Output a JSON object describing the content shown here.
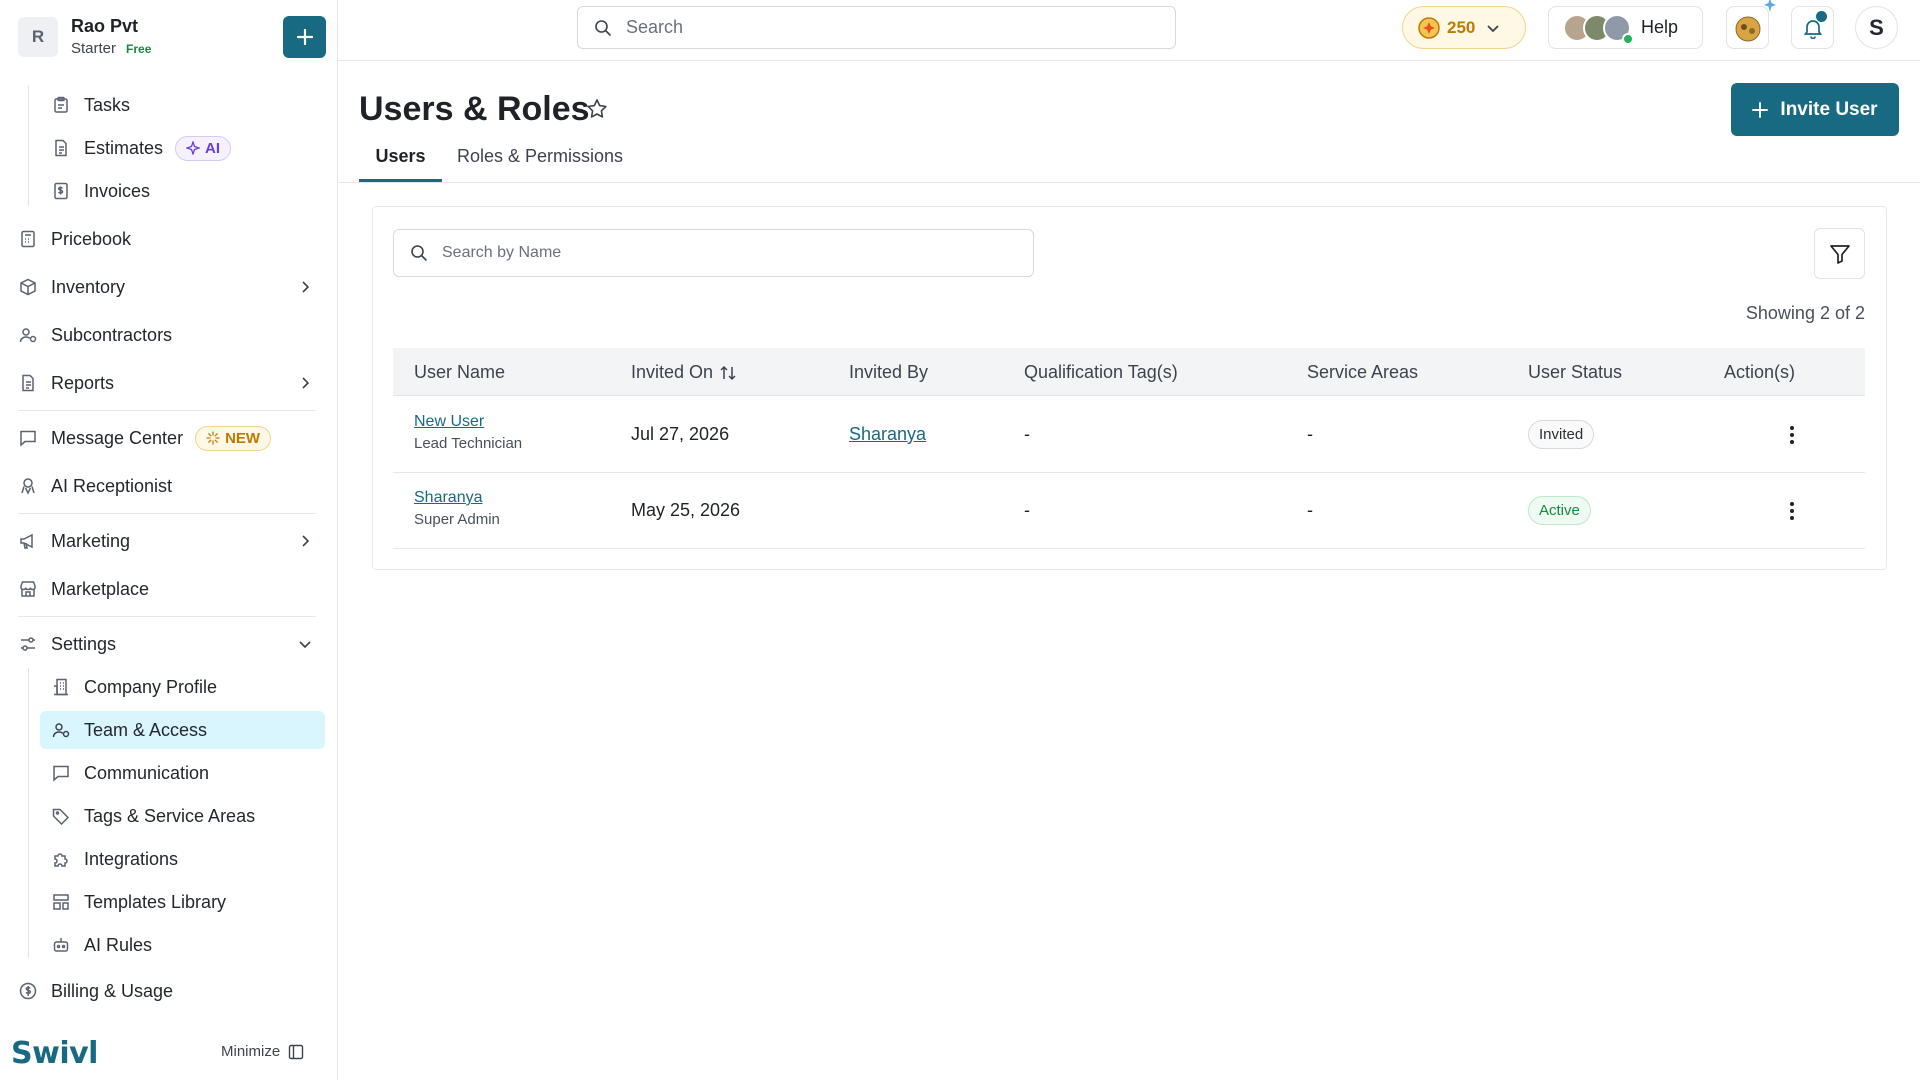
{
  "brand": {
    "initial": "R",
    "name": "Rao Pvt",
    "plan": "Starter",
    "plan_tag": "Free"
  },
  "sidebar": {
    "project_items": [
      {
        "label": "Tasks",
        "icon": "clipboard-icon"
      },
      {
        "label": "Estimates",
        "icon": "document-icon",
        "badge": "AI"
      },
      {
        "label": "Invoices",
        "icon": "invoice-icon"
      }
    ],
    "items": [
      {
        "label": "Pricebook",
        "icon": "calculator-icon"
      },
      {
        "label": "Inventory",
        "icon": "box-icon"
      },
      {
        "label": "Subcontractors",
        "icon": "people-icon"
      },
      {
        "label": "Reports",
        "icon": "report-icon"
      },
      {
        "label": "Message Center",
        "icon": "chat-icon",
        "badge": "NEW"
      },
      {
        "label": "AI Receptionist",
        "icon": "receptionist-icon"
      },
      {
        "label": "Marketing",
        "icon": "megaphone-icon"
      },
      {
        "label": "Marketplace",
        "icon": "store-icon"
      },
      {
        "label": "Settings",
        "icon": "sliders-icon"
      }
    ],
    "settings_items": [
      {
        "label": "Company Profile"
      },
      {
        "label": "Team & Access",
        "active": true
      },
      {
        "label": "Communication"
      },
      {
        "label": "Tags & Service Areas"
      },
      {
        "label": "Integrations"
      },
      {
        "label": "Templates Library"
      },
      {
        "label": "AI Rules"
      }
    ],
    "billing": "Billing & Usage",
    "logo": "Swivl",
    "minimize": "Minimize"
  },
  "topbar": {
    "search_placeholder": "Search",
    "coins": "250",
    "help": "Help",
    "user_initial": "S"
  },
  "page": {
    "title": "Users & Roles",
    "invite_label": "Invite User",
    "tabs": [
      {
        "label": "Users",
        "active": true
      },
      {
        "label": "Roles & Permissions",
        "active": false
      }
    ],
    "name_search_placeholder": "Search by Name",
    "showing": "Showing 2 of 2"
  },
  "table": {
    "headers": [
      "User Name",
      "Invited On",
      "Invited By",
      "Qualification Tag(s)",
      "Service Areas",
      "User Status",
      "Action(s)"
    ],
    "rows": [
      {
        "name": "New User",
        "role": "Lead Technician",
        "invited_on": "Jul 27, 2026",
        "invited_by": "Sharanya",
        "tags": "-",
        "areas": "-",
        "status": "Invited"
      },
      {
        "name": "Sharanya",
        "role": "Super Admin",
        "invited_on": "May 25, 2026",
        "invited_by": "",
        "tags": "-",
        "areas": "-",
        "status": "Active"
      }
    ]
  },
  "colors": {
    "brand": "#176a82",
    "active_bg": "#d9f5fd",
    "active_status": "#138a3e",
    "coins": "#c07a00"
  }
}
